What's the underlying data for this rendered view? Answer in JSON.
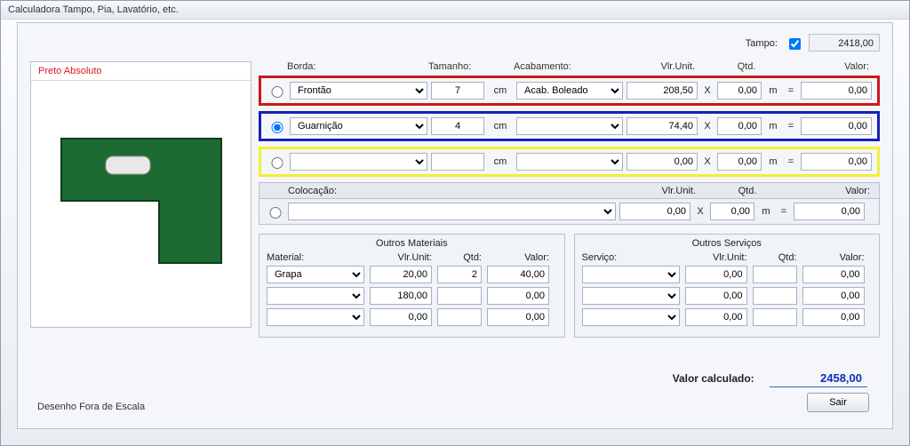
{
  "window": {
    "title": "Calculadora Tampo, Pia, Lavatório, etc."
  },
  "top": {
    "tampo_label": "Tampo:",
    "tampo_checked": true,
    "tampo_value": "2418,00"
  },
  "left": {
    "material_name": "Preto Absoluto"
  },
  "headers": {
    "borda": "Borda:",
    "tamanho": "Tamanho:",
    "acabamento": "Acabamento:",
    "vlrunit": "Vlr.Unit.",
    "qtd": "Qtd.",
    "valor": "Valor:",
    "cm": "cm",
    "x": "X",
    "m": "m",
    "eq": "="
  },
  "rows": [
    {
      "borda": "Frontão",
      "tamanho": "7",
      "acab": "Acab. Boleado",
      "vlr": "208,50",
      "qtd": "0,00",
      "valor": "0,00"
    },
    {
      "borda": "Guarnição",
      "tamanho": "4",
      "acab": "",
      "vlr": "74,40",
      "qtd": "0,00",
      "valor": "0,00"
    },
    {
      "borda": "",
      "tamanho": "",
      "acab": "",
      "vlr": "0,00",
      "qtd": "0,00",
      "valor": "0,00"
    }
  ],
  "coloc": {
    "label": "Colocação:",
    "vlrunit_label": "Vlr.Unit.",
    "qtd_label": "Qtd.",
    "valor_label": "Valor:",
    "vlr": "0,00",
    "qtd": "0,00",
    "valor": "0,00"
  },
  "outros_materiais": {
    "title": "Outros Materiais",
    "cols": {
      "material": "Material:",
      "vlrunit": "Vlr.Unit:",
      "qtd": "Qtd:",
      "valor": "Valor:"
    },
    "rows": [
      {
        "material": "Grapa",
        "vlr": "20,00",
        "qtd": "2",
        "valor": "40,00"
      },
      {
        "material": "",
        "vlr": "180,00",
        "qtd": "",
        "valor": "0,00"
      },
      {
        "material": "",
        "vlr": "0,00",
        "qtd": "",
        "valor": "0,00"
      }
    ]
  },
  "outros_servicos": {
    "title": "Outros Serviços",
    "cols": {
      "servico": "Serviço:",
      "vlrunit": "Vlr.Unit:",
      "qtd": "Qtd:",
      "valor": "Valor:"
    },
    "rows": [
      {
        "servico": "",
        "vlr": "0,00",
        "qtd": "",
        "valor": "0,00"
      },
      {
        "servico": "",
        "vlr": "0,00",
        "qtd": "",
        "valor": "0,00"
      },
      {
        "servico": "",
        "vlr": "0,00",
        "qtd": "",
        "valor": "0,00"
      }
    ]
  },
  "footer": {
    "label": "Valor calculado:",
    "value": "2458,00"
  },
  "scale_note": "Desenho Fora de Escala",
  "buttons": {
    "sair": "Sair"
  }
}
